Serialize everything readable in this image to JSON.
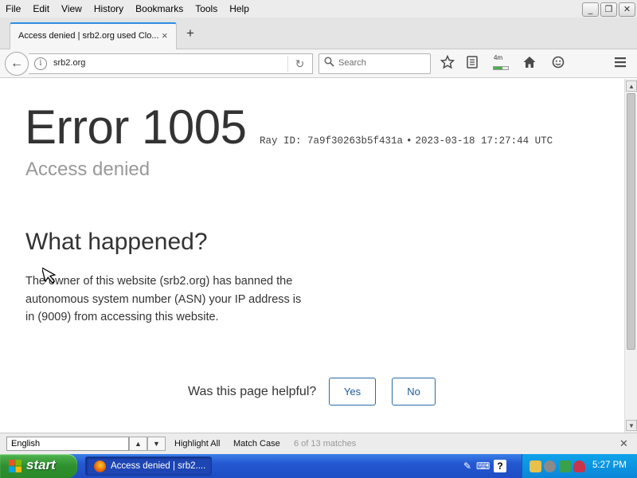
{
  "menu": [
    "File",
    "Edit",
    "View",
    "History",
    "Bookmarks",
    "Tools",
    "Help"
  ],
  "window_controls": {
    "minimize": "_",
    "maximize": "❐",
    "close": "✕"
  },
  "tab": {
    "title": "Access denied | srb2.org used Clo...",
    "close": "×",
    "new_tab": "+"
  },
  "navbar": {
    "back": "←",
    "info": "i",
    "url": "srb2.org",
    "reload": "↻",
    "search_placeholder": "Search",
    "downloads_text": "4m",
    "downloads_progress": 0.6,
    "icons": [
      "back-icon",
      "info-icon",
      "reload-icon",
      "search-icon",
      "bookmark-star-icon",
      "reader-view-icon",
      "downloads-icon",
      "home-icon",
      "account-icon",
      "hamburger-menu-icon"
    ]
  },
  "page": {
    "error_title": "Error 1005",
    "ray_label": "Ray ID: 7a9f30263b5f431a",
    "bullet": "•",
    "timestamp": "2023-03-18 17:27:44 UTC",
    "subtitle": "Access denied",
    "heading": "What happened?",
    "body": "The owner of this website (srb2.org) has banned the autonomous system number (ASN) your IP address is in (9009) from accessing this website.",
    "helpful_question": "Was this page helpful?",
    "yes": "Yes",
    "no": "No"
  },
  "findbar": {
    "query": "English",
    "prev": "▲",
    "next": "▼",
    "highlight_all": "Highlight All",
    "match_case": "Match Case",
    "match_count": "6 of 13 matches",
    "close": "✕"
  },
  "taskbar": {
    "start": "start",
    "task_label": "Access denied | srb2....",
    "quick_launch": {
      "pen": "✎",
      "lang": "⌨",
      "help": "?"
    },
    "clock": "5:27 PM"
  },
  "colors": {
    "accent": "#2a6aa8",
    "tab_highlight": "#2d8be3",
    "taskbar": "#2458d1",
    "start": "#2f8f2f"
  }
}
